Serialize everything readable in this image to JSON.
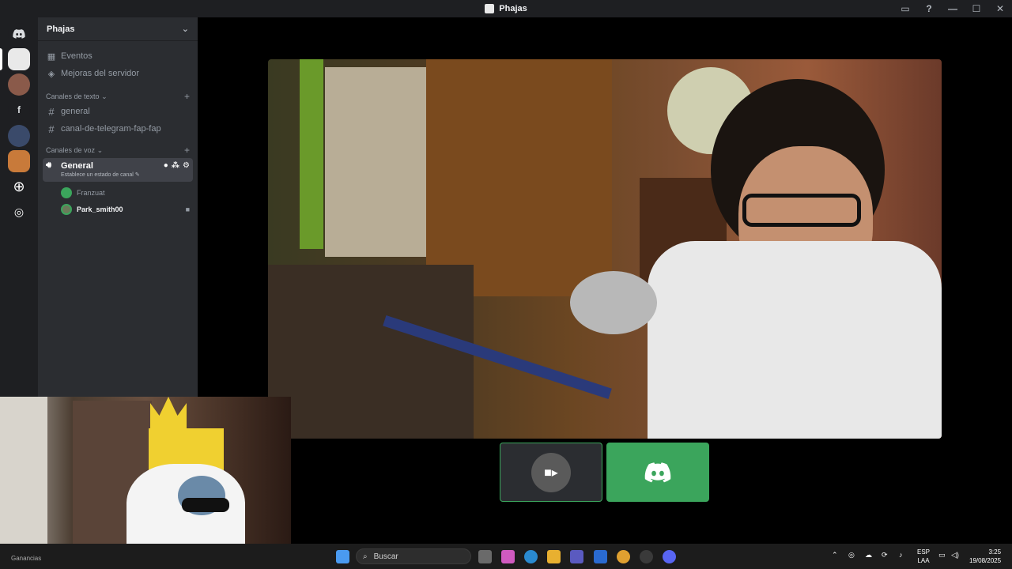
{
  "window": {
    "title": "Phajas"
  },
  "server": {
    "name": "Phajas"
  },
  "sidebar": {
    "top_items": [
      {
        "label": "Eventos",
        "icon": "calendar-icon"
      },
      {
        "label": "Mejoras del servidor",
        "icon": "boost-icon"
      }
    ],
    "text_category": "Canales de texto",
    "text_channels": [
      "general",
      "canal-de-telegram-fap-fap"
    ],
    "voice_category": "Canales de voz",
    "voice_channel": {
      "name": "General",
      "status_placeholder": "Establece un estado de canal"
    },
    "voice_users": [
      {
        "name": "Franzuat"
      },
      {
        "name": "Park_smith00"
      }
    ]
  },
  "taskbar": {
    "search_placeholder": "Buscar",
    "lang_top": "ESP",
    "lang_bottom": "LAA",
    "time": "3:25",
    "date": "19/08/2025",
    "hidden_widget": "Ganancias"
  },
  "colors": {
    "accent_green": "#3ba55c",
    "discord_blurple": "#5865f2"
  }
}
